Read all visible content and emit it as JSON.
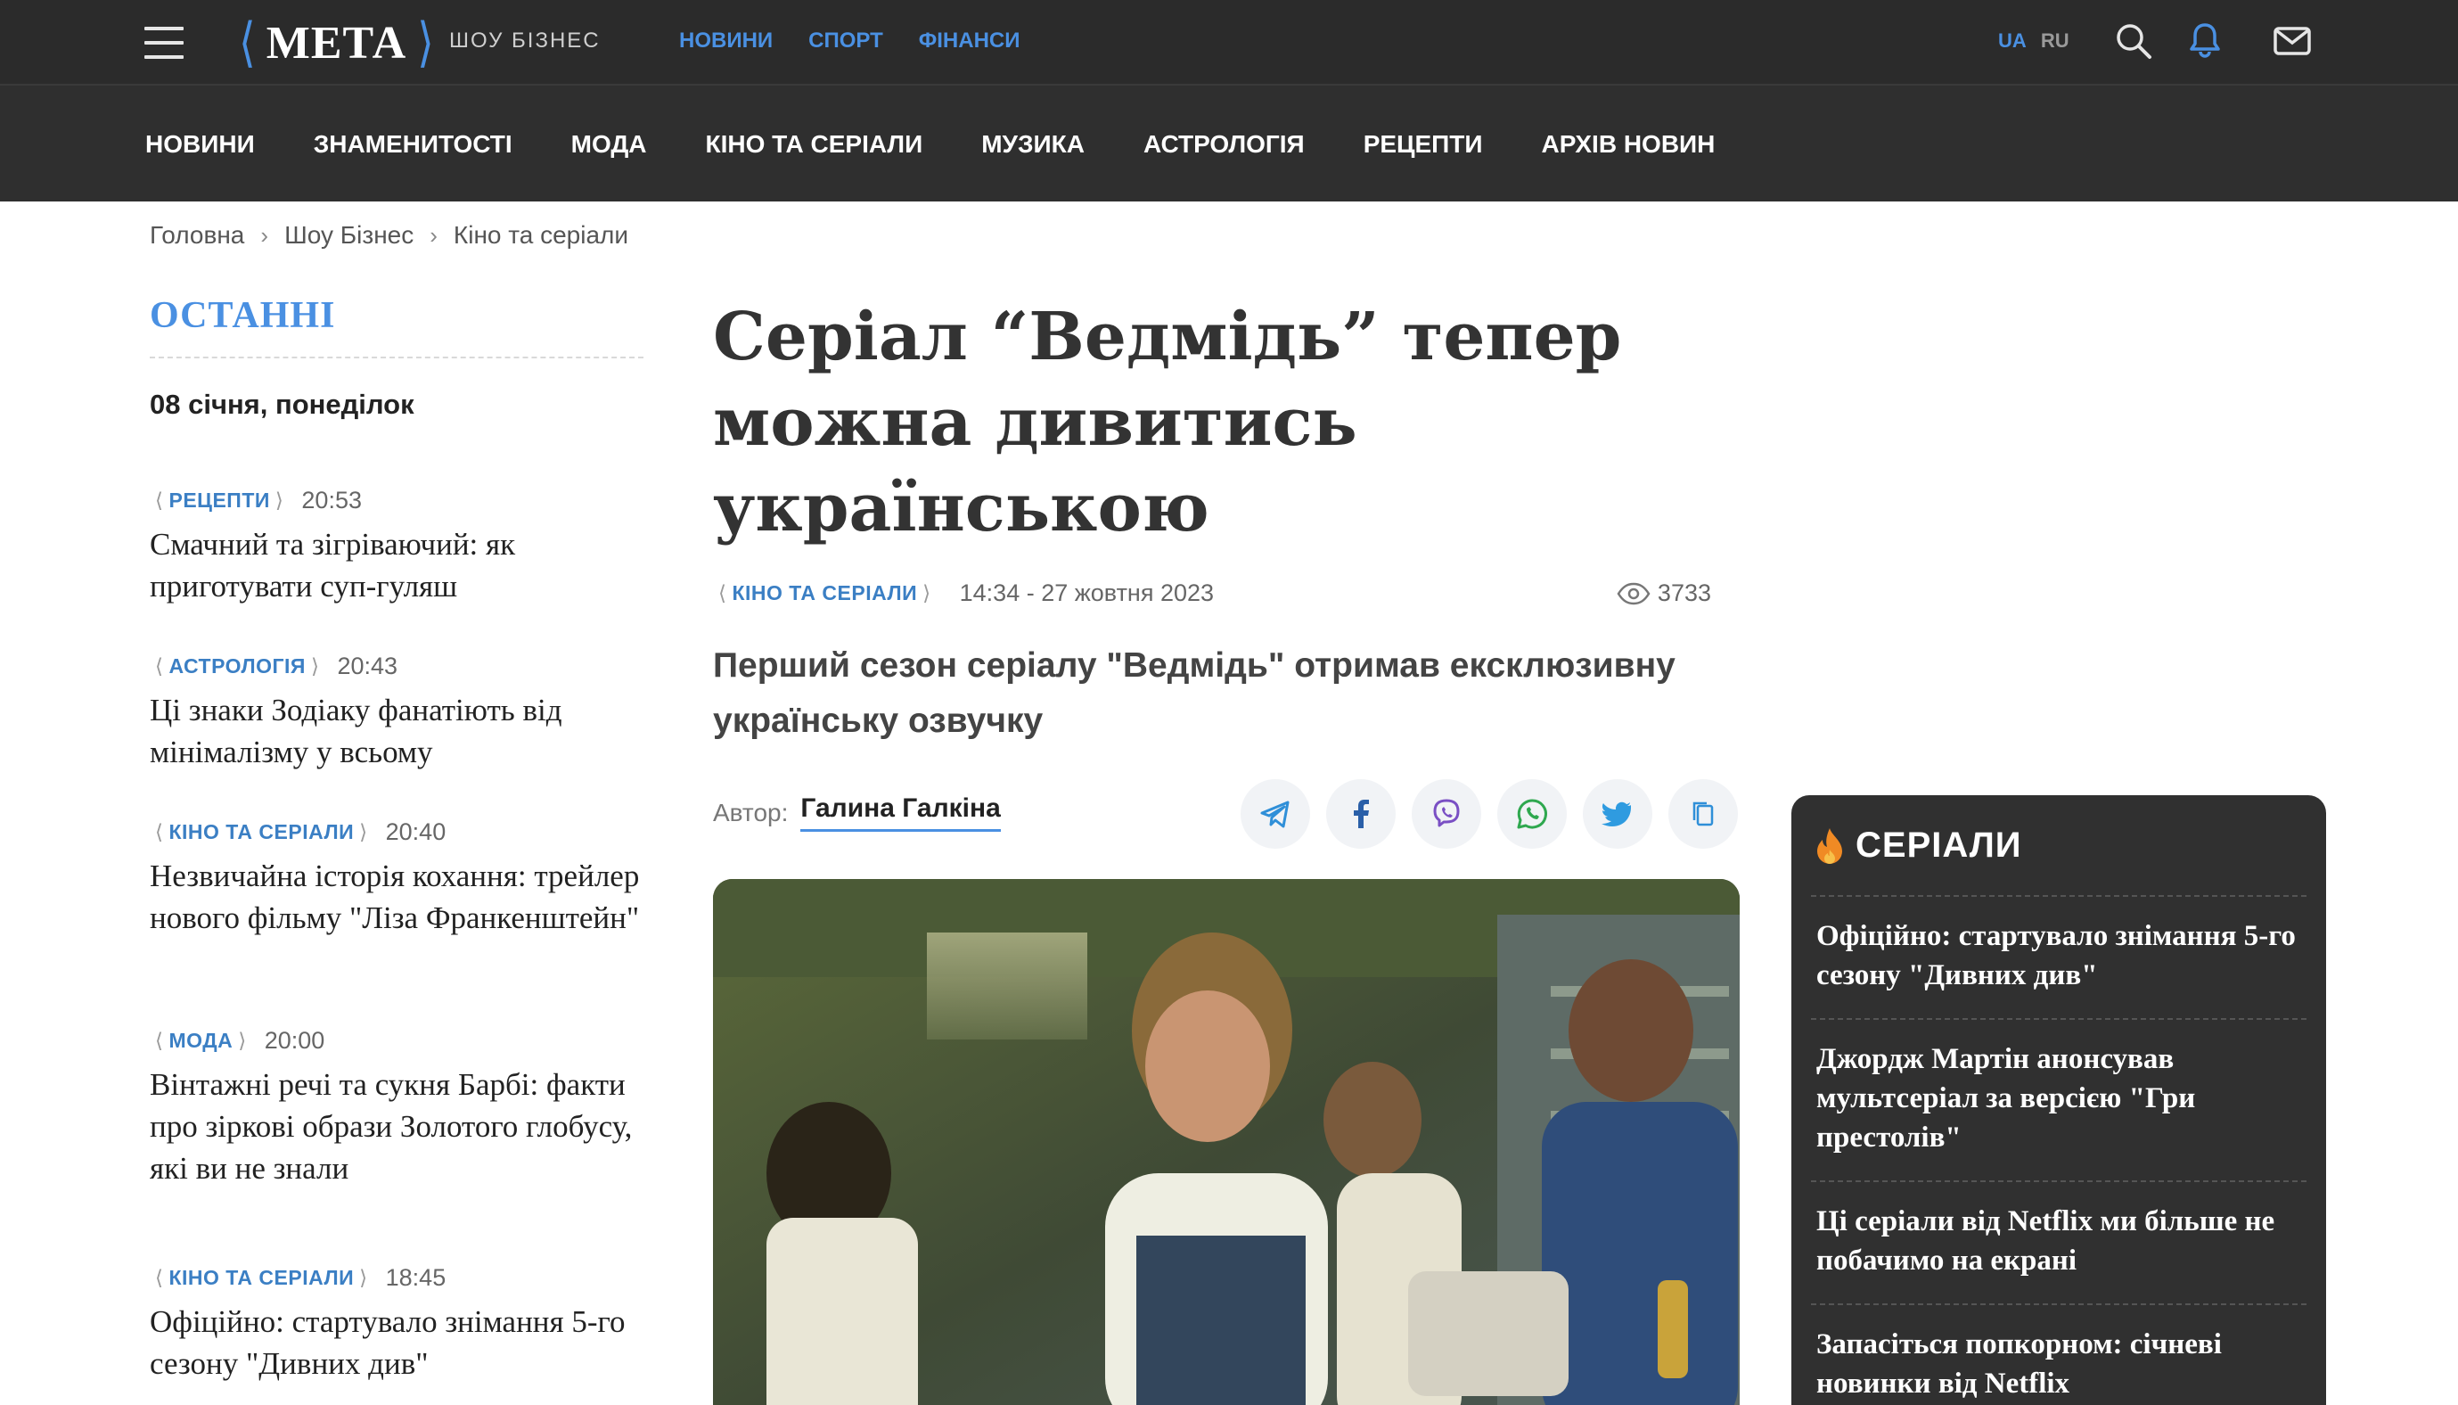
{
  "header": {
    "logo": "МЕТА",
    "logo_section": "ШОУ БІЗНЕС",
    "top_links": [
      "НОВИНИ",
      "СПОРТ",
      "ФІНАНСИ"
    ],
    "lang_ua": "UA",
    "lang_ru": "RU"
  },
  "nav": {
    "items": [
      "НОВИНИ",
      "ЗНАМЕНИТОСТІ",
      "МОДА",
      "КІНО ТА СЕРІАЛИ",
      "МУЗИКА",
      "АСТРОЛОГІЯ",
      "РЕЦЕПТИ",
      "АРХІВ НОВИН"
    ]
  },
  "breadcrumb": [
    "Головна",
    "Шоу Бізнес",
    "Кіно та серіали"
  ],
  "latest": {
    "title": "ОСТАННІ",
    "date": "08 січня, понеділок",
    "items": [
      {
        "tag": "РЕЦЕПТИ",
        "time": "20:53",
        "title": "Смачний та зігріваючий: як приготувати суп-гуляш"
      },
      {
        "tag": "АСТРОЛОГІЯ",
        "time": "20:43",
        "title": "Ці знаки Зодіаку фанатіють від мінімалізму у всьому"
      },
      {
        "tag": "КІНО ТА СЕРІАЛИ",
        "time": "20:40",
        "title": "Незвичайна історія кохання: трейлер нового фільму \"Ліза Франкенштейн\""
      },
      {
        "tag": "МОДА",
        "time": "20:00",
        "title": "Вінтажні речі та сукня Барбі: факти про зіркові образи Золотого глобусу, які ви не знали"
      },
      {
        "tag": "КІНО ТА СЕРІАЛИ",
        "time": "18:45",
        "title": "Офіційно: стартувало знімання 5-го сезону \"Дивних див\""
      }
    ]
  },
  "article": {
    "headline": "Серіал “Ведмідь” тепер можна дивитись українською",
    "tag": "КІНО ТА СЕРІАЛИ",
    "datetime": "14:34 - 27 жовтня 2023",
    "views": "3733",
    "lead": "Перший сезон серіалу \"Ведмідь\" отримав ексклюзивну українську озвучку",
    "author_label": "Автор:",
    "author": "Галина Галкіна"
  },
  "share": [
    "telegram-icon",
    "facebook-icon",
    "viber-icon",
    "whatsapp-icon",
    "twitter-icon",
    "copy-icon"
  ],
  "series": {
    "title": "СЕРІАЛИ",
    "items": [
      "Офіційно: стартувало знімання 5-го сезону \"Дивних див\"",
      "Джордж Мартін анонсував мультсеріал за версією \"Гри престолів\"",
      "Ці серіали від Netflix ми більше не побачимо на екрані",
      "Запасіться попкорном: січневі новинки від Netflix"
    ]
  },
  "colors": {
    "accent": "#4a90e2",
    "header_bg": "#2b2b2b",
    "nav_bg": "#2f2f2f",
    "sidebar_bg": "#303030"
  }
}
